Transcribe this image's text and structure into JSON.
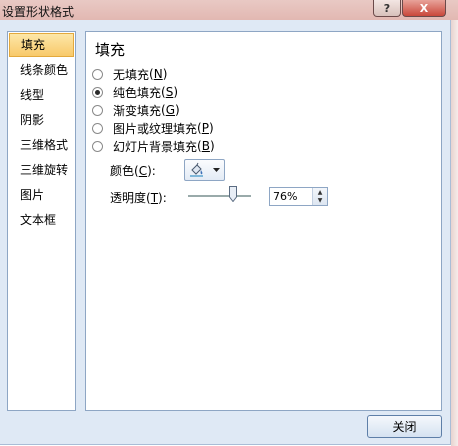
{
  "window": {
    "title": "设置形状格式"
  },
  "titlebar_buttons": {
    "help": "?",
    "close": "X"
  },
  "nav": {
    "items": [
      {
        "label": "填充",
        "active": true
      },
      {
        "label": "线条颜色"
      },
      {
        "label": "线型"
      },
      {
        "label": "阴影"
      },
      {
        "label": "三维格式"
      },
      {
        "label": "三维旋转"
      },
      {
        "label": "图片"
      },
      {
        "label": "文本框"
      }
    ]
  },
  "fill": {
    "title": "填充",
    "options": [
      {
        "label": "无填充",
        "key": "N",
        "checked": false
      },
      {
        "label": "纯色填充",
        "key": "S",
        "checked": true
      },
      {
        "label": "渐变填充",
        "key": "G",
        "checked": false
      },
      {
        "label": "图片或纹理填充",
        "key": "P",
        "checked": false
      },
      {
        "label": "幻灯片背景填充",
        "key": "B",
        "checked": false
      }
    ],
    "color_label": "颜色",
    "color_key": "C",
    "transparency_label": "透明度",
    "transparency_key": "T",
    "transparency_value": "76%",
    "transparency_fraction": 0.76
  },
  "footer": {
    "close_label": "关闭"
  },
  "colors": {
    "accent_active": "#f8c96a",
    "frame_bg": "#dfe9f5",
    "border": "#8ea6c4"
  },
  "icons": {
    "fill_bucket": "paint-bucket-icon",
    "dropdown": "chevron-down-icon"
  }
}
